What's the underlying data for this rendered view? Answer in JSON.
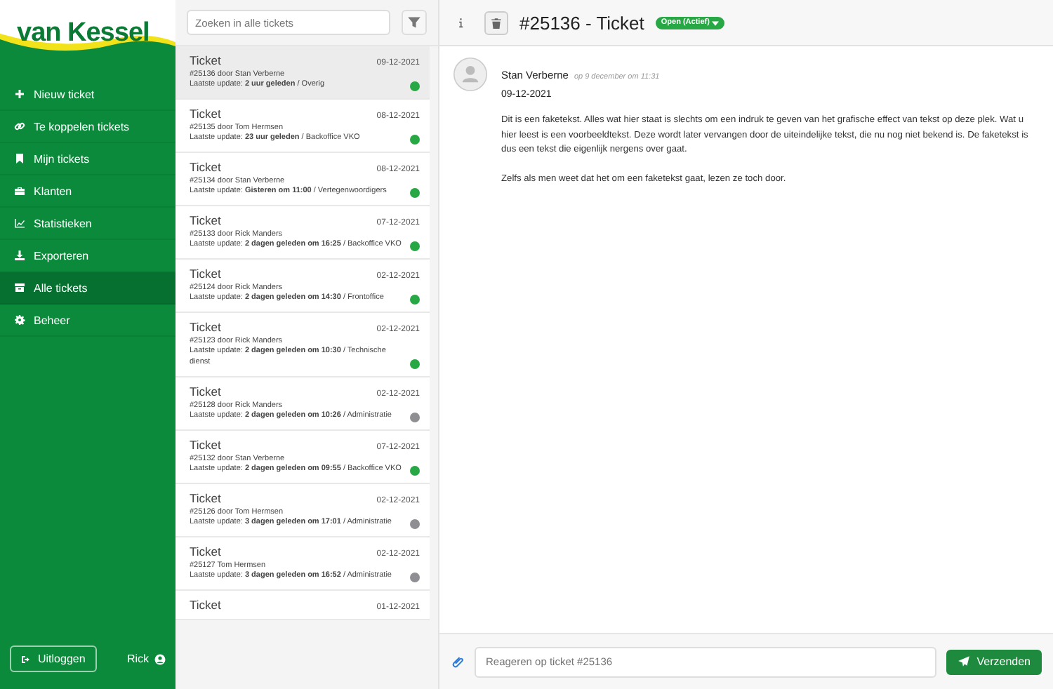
{
  "brand": {
    "logo_text": "van Kessel"
  },
  "nav": {
    "items": [
      {
        "label": "Nieuw ticket",
        "kind": "plus",
        "selected": false
      },
      {
        "label": "Te koppelen tickets",
        "kind": "link",
        "selected": false
      },
      {
        "label": "Mijn tickets",
        "kind": "bookmark",
        "selected": false
      },
      {
        "label": "Klanten",
        "kind": "briefcase",
        "selected": false
      },
      {
        "label": "Statistieken",
        "kind": "chart",
        "selected": false
      },
      {
        "label": "Exporteren",
        "kind": "download",
        "selected": false
      },
      {
        "label": "Alle tickets",
        "kind": "archive",
        "selected": true
      },
      {
        "label": "Beheer",
        "kind": "gear",
        "selected": false
      }
    ],
    "logout": "Uitloggen",
    "user": "Rick"
  },
  "search": {
    "placeholder": "Zoeken in alle tickets"
  },
  "tickets": [
    {
      "title": "Ticket",
      "date": "09-12-2021",
      "meta": "#25136 door Stan Verberne",
      "update": "Laatste update: **2 uur geleden** / Overig",
      "color": "#28a745",
      "selected": true
    },
    {
      "title": "Ticket",
      "date": "08-12-2021",
      "meta": "#25135 door Tom Hermsen",
      "update": "Laatste update: **23 uur geleden** / Backoffice VKO",
      "color": "#28a745",
      "selected": false
    },
    {
      "title": "Ticket",
      "date": "08-12-2021",
      "meta": "#25134 door Stan Verberne",
      "update": "Laatste update: **Gisteren om 11:00** / Vertegenwoordigers",
      "color": "#28a745",
      "selected": false
    },
    {
      "title": "Ticket",
      "date": "07-12-2021",
      "meta": "#25133 door Rick Manders",
      "update": "Laatste update: **2 dagen geleden om 16:25** / Backoffice VKO",
      "color": "#28a745",
      "selected": false
    },
    {
      "title": "Ticket",
      "date": "02-12-2021",
      "meta": "#25124 door Rick Manders",
      "update": "Laatste update: **2 dagen geleden om 14:30** / Frontoffice",
      "color": "#28a745",
      "selected": false
    },
    {
      "title": "Ticket",
      "date": "02-12-2021",
      "meta": "#25123 door Rick Manders",
      "update": "Laatste update: **2 dagen geleden om 10:30** / Technische dienst",
      "color": "#28a745",
      "selected": false
    },
    {
      "title": "Ticket",
      "date": "02-12-2021",
      "meta": "#25128 door Rick Manders",
      "update": "Laatste update: **2 dagen geleden om 10:26** / Administratie",
      "color": "#8e8e93",
      "selected": false
    },
    {
      "title": "Ticket",
      "date": "07-12-2021",
      "meta": "#25132 door Stan Verberne",
      "update": "Laatste update: **2 dagen geleden om 09:55** / Backoffice VKO",
      "color": "#28a745",
      "selected": false
    },
    {
      "title": "Ticket",
      "date": "02-12-2021",
      "meta": "#25126 door Tom Hermsen",
      "update": "Laatste update: **3 dagen geleden om 17:01** / Administratie",
      "color": "#8e8e93",
      "selected": false
    },
    {
      "title": "Ticket",
      "date": "02-12-2021",
      "meta": "#25127 Tom Hermsen",
      "update": "Laatste update: **3 dagen geleden om 16:52** / Administratie",
      "color": "#8e8e93",
      "selected": false
    },
    {
      "title": "Ticket",
      "date": "01-12-2021",
      "selected": false
    }
  ],
  "detail": {
    "title": "#25136 - Ticket",
    "status": "Open (Actief)",
    "message": {
      "author": "Stan Verberne",
      "when": "op 9 december om 11:31",
      "date": "09-12-2021",
      "paragraphs": [
        "Dit is een faketekst. Alles wat hier staat is slechts om een indruk te geven van het grafische effect van tekst op deze plek. Wat u hier leest is een voorbeeldtekst. Deze wordt later vervangen door de uiteindelijke tekst, die nu nog niet bekend is. De faketekst is dus een tekst die eigenlijk nergens over gaat.",
        "Zelfs als men weet dat het om een faketekst gaat, lezen ze toch door."
      ]
    },
    "reply": {
      "placeholder": "Reageren op ticket #25136",
      "send": "Verzenden"
    }
  }
}
